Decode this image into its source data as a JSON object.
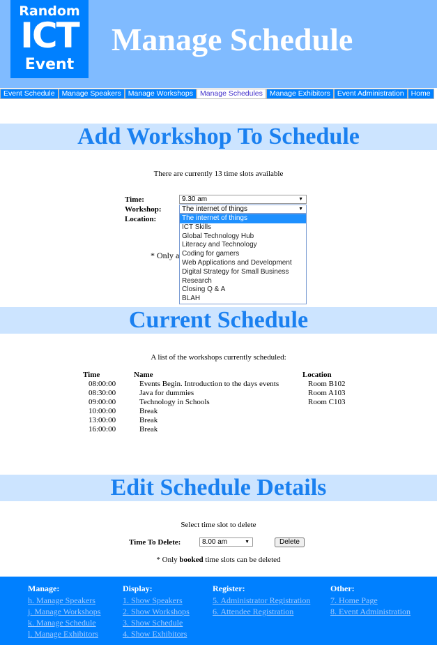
{
  "header": {
    "logo": {
      "line1": "Random",
      "line2": "ICT",
      "line3": "Event"
    },
    "title": "Manage Schedule"
  },
  "nav": [
    {
      "label": "Event Schedule"
    },
    {
      "label": "Manage Speakers"
    },
    {
      "label": "Manage Workshops"
    },
    {
      "label": "Manage Schedules",
      "active": true
    },
    {
      "label": "Manage Exhibitors"
    },
    {
      "label": "Event Administration"
    },
    {
      "label": "Home"
    }
  ],
  "add": {
    "heading": "Add Workshop To Schedule",
    "info": "There are currently 13 time slots available",
    "time_label": "Time:",
    "time_value": "9.30 am",
    "workshop_label": "Workshop:",
    "workshop_value": "The internet of things",
    "location_label": "Location:",
    "note_partial": "* Only a",
    "workshop_options": [
      "The internet of things",
      "ICT Skills",
      "Global Technology Hub",
      "Literacy and Technology",
      "Coding for gamers",
      "Web Applications and Development",
      "Digital Strategy for Small Business",
      "Research",
      "Closing Q & A",
      "BLAH"
    ]
  },
  "current": {
    "heading": "Current Schedule",
    "info": "A list of the workshops currently scheduled:",
    "columns": [
      "Time",
      "Name",
      "Location"
    ],
    "rows": [
      [
        "08:00:00",
        "Events Begin. Introduction to the days events",
        "Room B102"
      ],
      [
        "08:30:00",
        "Java for dummies",
        "Room A103"
      ],
      [
        "09:00:00",
        "Technology in Schools",
        "Room C103"
      ],
      [
        "10:00:00",
        "Break",
        ""
      ],
      [
        "13:00:00",
        "Break",
        ""
      ],
      [
        "16:00:00",
        "Break",
        ""
      ]
    ]
  },
  "edit": {
    "heading": "Edit Schedule Details",
    "info": "Select time slot to delete",
    "label": "Time To Delete:",
    "value": "8.00 am",
    "button": "Delete",
    "note_pre": "* Only ",
    "note_bold": "booked",
    "note_post": " time slots can be deleted"
  },
  "footer": [
    {
      "heading": "Manage:",
      "links": [
        "h. Manage Speakers",
        "j. Manage Workshops",
        "k. Manage Schedule",
        "l. Manage Exhibitors"
      ]
    },
    {
      "heading": "Display:",
      "links": [
        "1. Show Speakers",
        "2. Show Workshops",
        "3. Show Schedule",
        "4. Show Exhibitors"
      ]
    },
    {
      "heading": "Register:",
      "links": [
        "5. Administrator Registration",
        "6. Attendee Registration"
      ]
    },
    {
      "heading": "Other:",
      "links": [
        "7. Home Page",
        "8. Event Administration"
      ]
    }
  ]
}
